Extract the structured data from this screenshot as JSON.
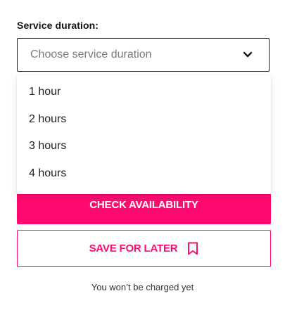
{
  "form": {
    "label": "Service duration:",
    "select": {
      "placeholder": "Choose service duration",
      "options": [
        "1 hour",
        "2 hours",
        "3 hours",
        "4 hours"
      ]
    }
  },
  "actions": {
    "check_availability": "CHECK AVAILABILITY",
    "save_for_later": "SAVE FOR LATER"
  },
  "footer": {
    "note": "You won’t be charged yet"
  },
  "icons": {
    "select_toggle": "chevron-down-icon",
    "save": "bookmark-icon"
  },
  "colors": {
    "accent": "#ff0a70",
    "border": "#222222",
    "placeholder": "#7a7a7a"
  }
}
